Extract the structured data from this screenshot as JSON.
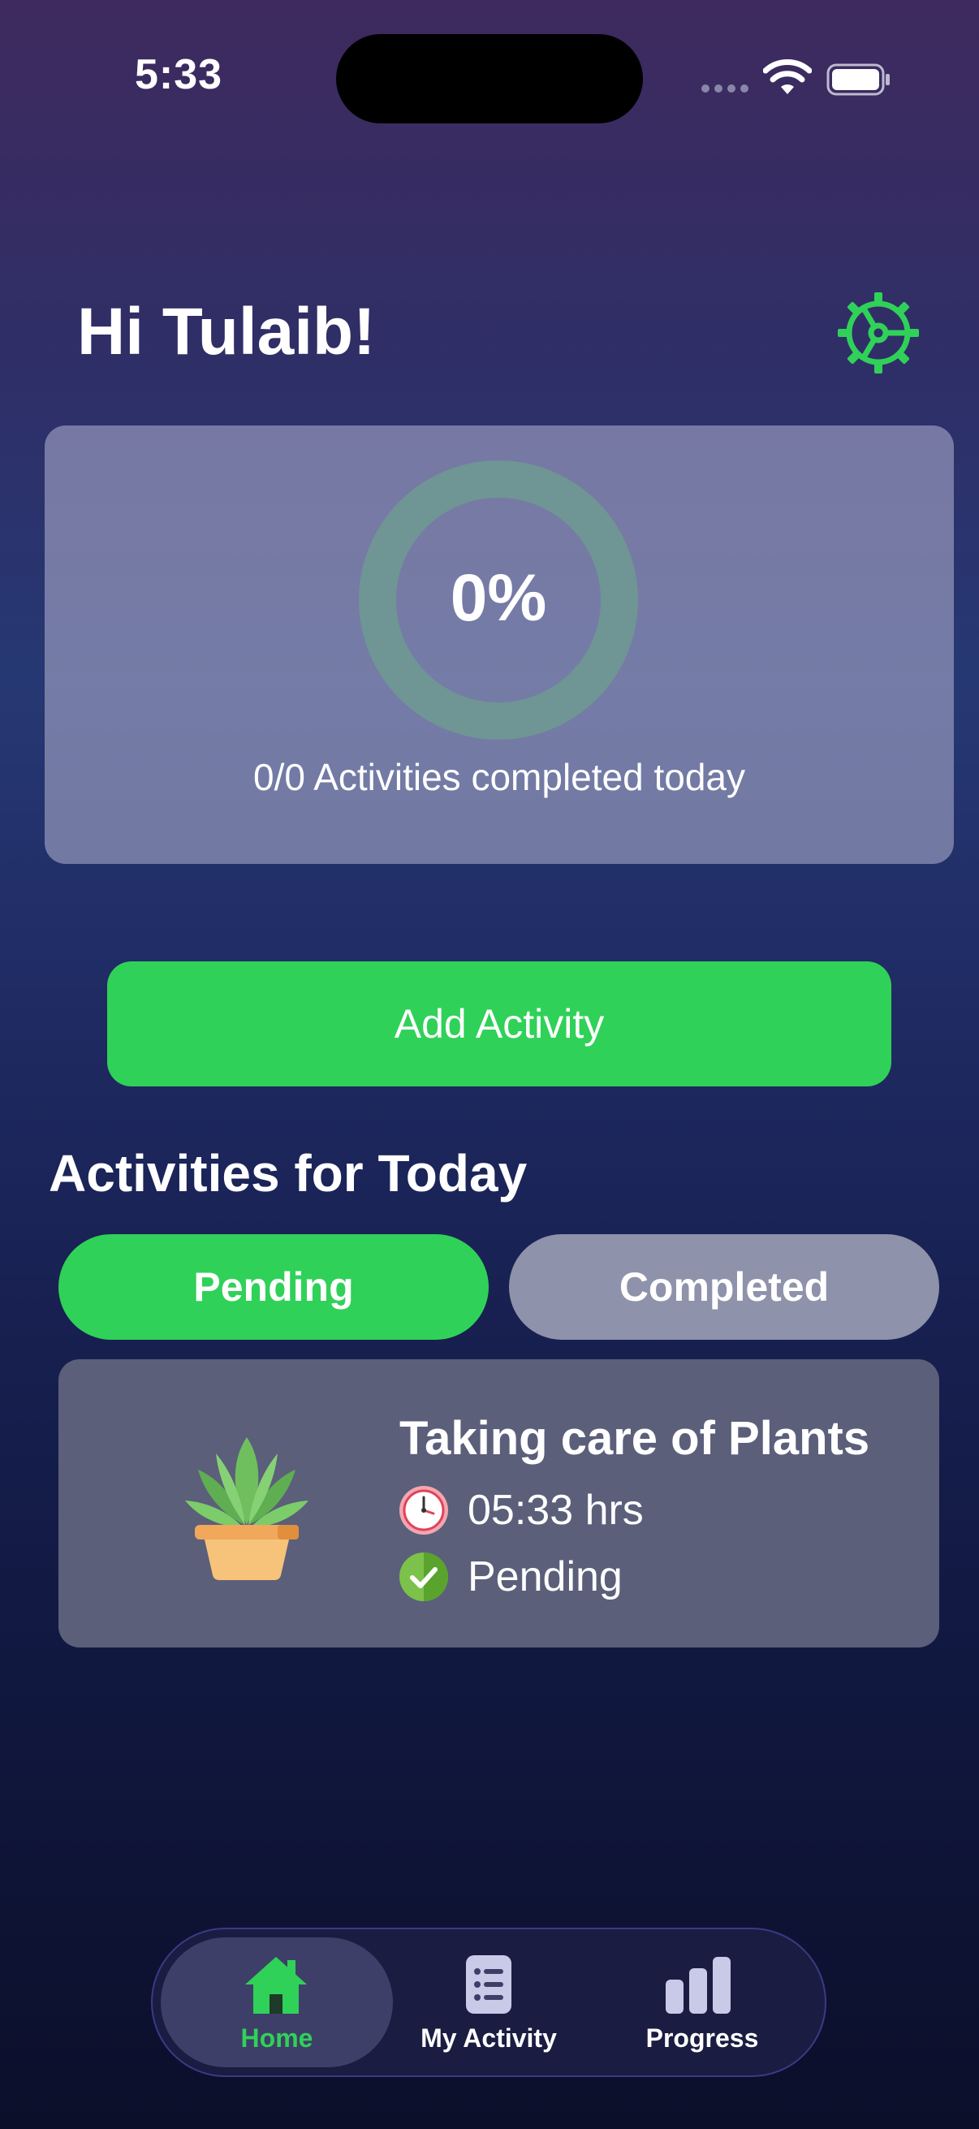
{
  "status_bar": {
    "time": "5:33"
  },
  "header": {
    "greeting": "Hi Tulaib!"
  },
  "progress": {
    "percent_label": "0%",
    "percent_value": 0,
    "summary": "0/0 Activities completed today"
  },
  "actions": {
    "add_activity": "Add Activity"
  },
  "section": {
    "title": "Activities for Today"
  },
  "segments": {
    "pending": "Pending",
    "completed": "Completed"
  },
  "activity": {
    "title": "Taking care of Plants",
    "time": "05:33 hrs",
    "status": "Pending"
  },
  "tabs": [
    {
      "label": "Home",
      "icon": "home-icon"
    },
    {
      "label": "My Activity",
      "icon": "list-icon"
    },
    {
      "label": "Progress",
      "icon": "bar-chart-icon"
    }
  ],
  "colors": {
    "accent": "#30d158",
    "card": "#5b5f7a",
    "segment_inactive": "#8e92aa"
  }
}
